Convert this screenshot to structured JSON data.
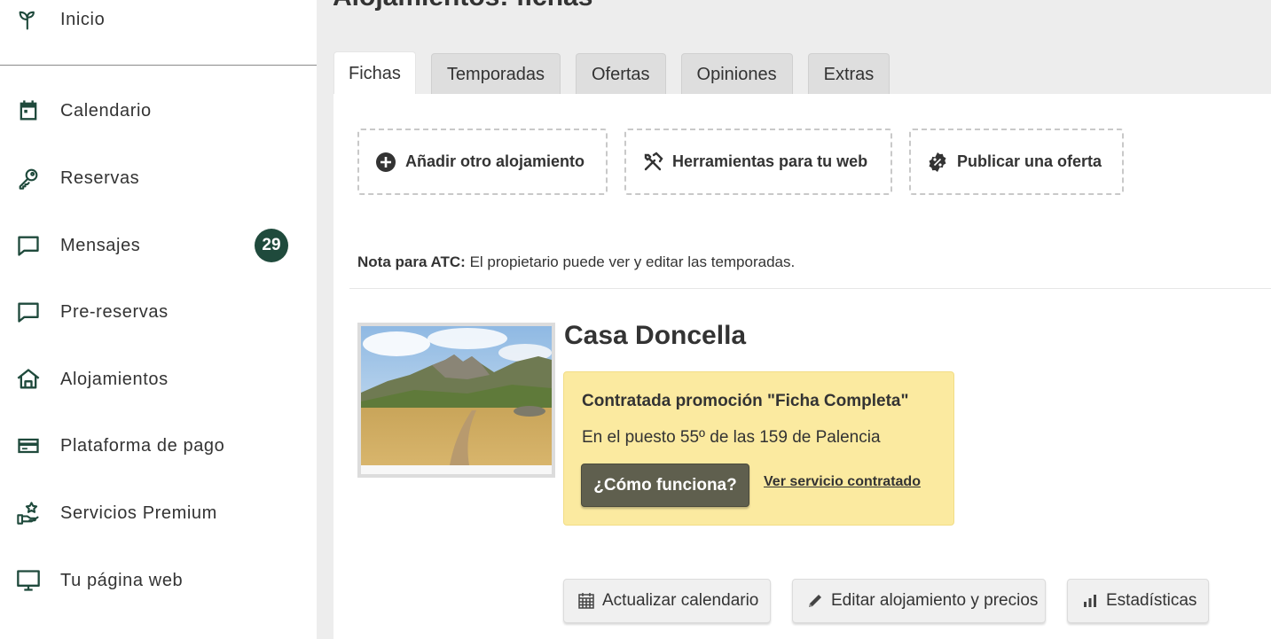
{
  "sidebar": {
    "items": [
      {
        "label": "Inicio",
        "icon": "sprout-icon"
      },
      {
        "label": "Calendario",
        "icon": "calendar-icon"
      },
      {
        "label": "Reservas",
        "icon": "key-icon"
      },
      {
        "label": "Mensajes",
        "icon": "chat-icon",
        "badge": "29"
      },
      {
        "label": "Pre-reservas",
        "icon": "chat-icon"
      },
      {
        "label": "Alojamientos",
        "icon": "house-icon"
      },
      {
        "label": "Plataforma de pago",
        "icon": "credit-card-icon"
      },
      {
        "label": "Servicios Premium",
        "icon": "hand-star-icon"
      },
      {
        "label": "Tu página web",
        "icon": "monitor-icon"
      }
    ]
  },
  "header": {
    "title": "Alojamientos: fichas"
  },
  "tabs": [
    {
      "label": "Fichas",
      "active": true
    },
    {
      "label": "Temporadas",
      "active": false
    },
    {
      "label": "Ofertas",
      "active": false
    },
    {
      "label": "Opiniones",
      "active": false
    },
    {
      "label": "Extras",
      "active": false
    }
  ],
  "actions": {
    "add_label": "Añadir otro alojamiento",
    "tools_label": "Herramientas para tu web",
    "offer_label": "Publicar una oferta"
  },
  "note": {
    "prefix": "Nota para ATC:",
    "text": " El propietario puede ver y editar las temporadas."
  },
  "property": {
    "name": "Casa Doncella",
    "promo": {
      "title": "Contratada promoción \"Ficha Completa\"",
      "rank_text": "En el puesto 55º de las 159 de Palencia",
      "how_label": "¿Cómo funciona?",
      "service_link": "Ver servicio contratado"
    },
    "buttons": {
      "calendar_label": "Actualizar calendario",
      "edit_label": "Editar alojamiento y precios",
      "stats_label": "Estadísticas"
    }
  },
  "colors": {
    "accent": "#1f4a3c",
    "promo_bg": "#fbeaa0",
    "promo_button": "#5f5f4e",
    "main_bg": "#ededed"
  }
}
